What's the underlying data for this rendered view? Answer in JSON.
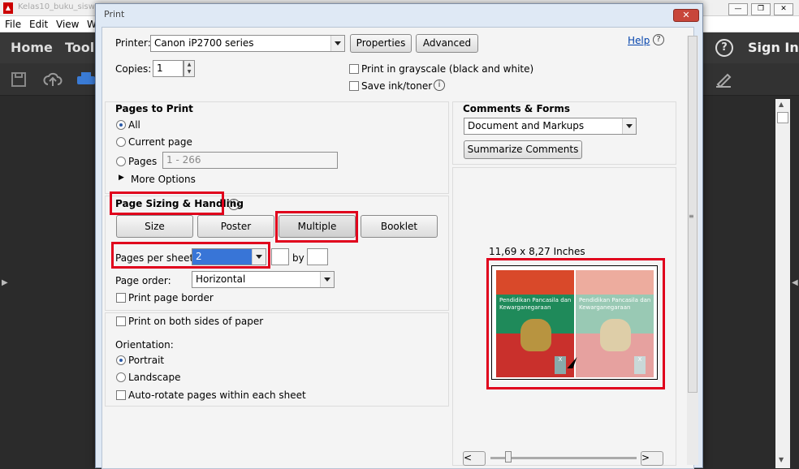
{
  "app": {
    "title": "Kelas10_buku_sisw",
    "menu": [
      "File",
      "Edit",
      "View",
      "W"
    ],
    "toolbar": {
      "home": "Home",
      "tools": "Tools",
      "sign_in": "Sign In",
      "help_glyph": "?"
    }
  },
  "dialog": {
    "title": "Print",
    "close_glyph": "✕",
    "printer_label": "Printer:",
    "printer_value": "Canon iP2700 series",
    "properties_button": "Properties",
    "advanced_button": "Advanced",
    "help_link": "Help",
    "copies_label": "Copies:",
    "copies_value": "1",
    "grayscale_label": "Print in grayscale (black and white)",
    "save_ink_label": "Save ink/toner",
    "pages_to_print": {
      "heading": "Pages to Print",
      "all": "All",
      "current_page": "Current page",
      "pages": "Pages",
      "pages_placeholder": "1 - 266",
      "more_options": "More Options"
    },
    "page_sizing": {
      "heading": "Page Sizing & Handling",
      "size_button": "Size",
      "poster_button": "Poster",
      "multiple_button": "Multiple",
      "booklet_button": "Booklet",
      "pages_per_sheet_label": "Pages per sheet:",
      "pages_per_sheet_value": "2",
      "by_label": "by",
      "page_order_label": "Page order:",
      "page_order_value": "Horizontal",
      "print_page_border": "Print page border"
    },
    "print_both_sides": "Print on both sides of paper",
    "orientation": {
      "heading": "Orientation:",
      "portrait": "Portrait",
      "landscape": "Landscape",
      "auto_rotate": "Auto-rotate pages within each sheet"
    },
    "comments_forms": {
      "heading": "Comments & Forms",
      "value": "Document and Markups",
      "summarize_button": "Summarize Comments"
    },
    "preview": {
      "size_text": "11,69 x 8,27 Inches",
      "cover_title": "Pendidikan Pancasila dan Kewarganegaraan",
      "slider_prev": "<",
      "slider_next": ">"
    }
  },
  "colors": {
    "highlight": "#e0001c",
    "selection": "#3875d7"
  }
}
